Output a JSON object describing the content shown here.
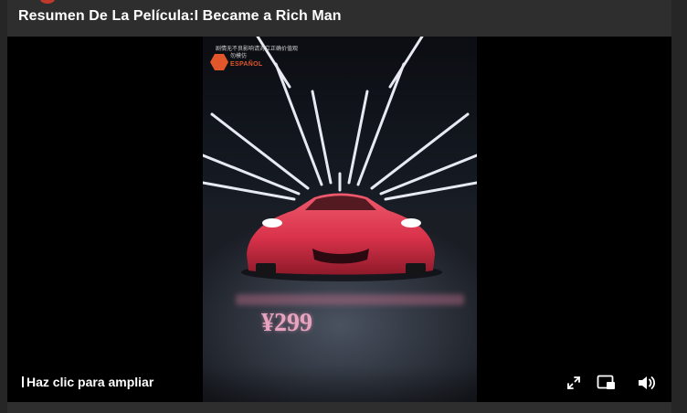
{
  "header": {
    "title": "Resumen De La Película:I Became a Rich Man"
  },
  "video": {
    "watermark_line1": "剧情无不良影响请对立正确价值观",
    "watermark_line2": "勿模仿",
    "logo_text": "ESPAÑOL",
    "price": "¥299"
  },
  "controls": {
    "enlarge_hint": "Haz clic para ampliar",
    "icons": {
      "fullscreen": "fullscreen-icon",
      "pip": "picture-in-picture-icon",
      "volume": "volume-icon"
    }
  },
  "colors": {
    "car": "#d8324a",
    "price": "#e8a4bf",
    "logo": "#e2562b"
  }
}
